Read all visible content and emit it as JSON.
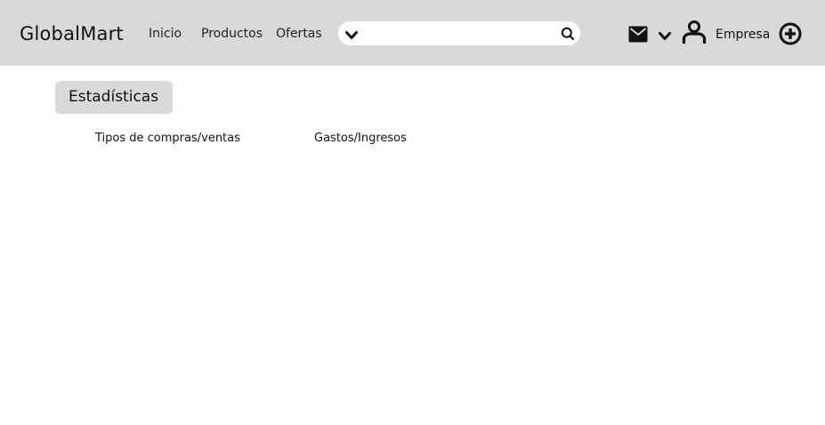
{
  "header": {
    "brand": "GlobalMart",
    "nav": {
      "inicio": "Inicio",
      "productos": "Productos",
      "ofertas": "Ofertas"
    },
    "search": {
      "placeholder": "",
      "value": ""
    },
    "company_label": "Empresa",
    "icons": {
      "filter": "chevron-down-icon",
      "search": "search-icon",
      "mail": "mail-icon",
      "mail_menu": "chevron-down-icon",
      "user": "user-icon",
      "add": "add-circle-icon"
    }
  },
  "main": {
    "section_tab": "Estadísticas",
    "charts": {
      "left_label": "Tipos de compras/ventas",
      "right_label": "Gastos/Ingresos"
    }
  },
  "colors": {
    "topbar": "#d9d9d9",
    "tab": "#d9d9d9",
    "background": "#ffffff",
    "icon": "#111111"
  }
}
